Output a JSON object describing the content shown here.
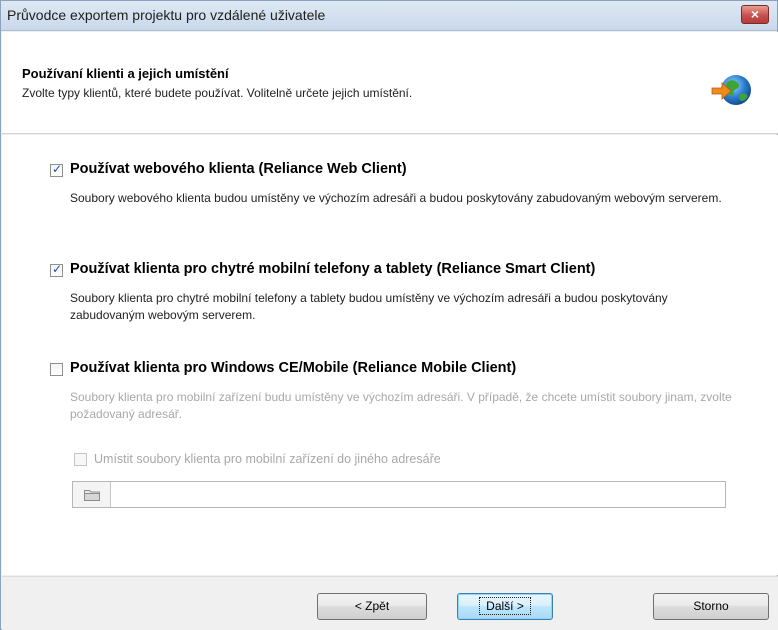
{
  "window": {
    "title": "Průvodce exportem projektu pro vzdálené uživatele",
    "close_symbol": "×"
  },
  "header": {
    "title": "Používaní klienti a jejich umístění",
    "subtitle": "Zvolte typy klientů, které budete používat. Volitelně určete jejich umístění.",
    "icon": "globe-arrow-icon"
  },
  "options": [
    {
      "label": "Používat webového klienta (Reliance Web Client)",
      "checked": true,
      "description": "Soubory webového klienta budou umístěny ve výchozím adresáři a budou poskytovány zabudovaným webovým serverem."
    },
    {
      "label": "Používat klienta pro chytré mobilní telefony a tablety (Reliance Smart Client)",
      "checked": true,
      "description": "Soubory klienta pro chytré mobilní telefony a tablety budou umístěny ve výchozím adresáři a budou poskytovány zabudovaným webovým serverem."
    },
    {
      "label": "Používat klienta pro Windows CE/Mobile (Reliance Mobile Client)",
      "checked": false,
      "description": "Soubory klienta pro mobilní zařízení budu umístěny ve výchozím adresáři. V případě, že chcete umístit soubory jinam, zvolte požadovaný adresář.",
      "sub_option": {
        "label": "Umístit soubory klienta pro mobilní zařízení do jiného adresáře",
        "checked": false,
        "enabled": false
      },
      "path": {
        "value": "",
        "icon": "folder-icon"
      }
    }
  ],
  "footer": {
    "back_label": "< Zpět",
    "next_label": "Další >",
    "cancel_label": "Storno"
  }
}
